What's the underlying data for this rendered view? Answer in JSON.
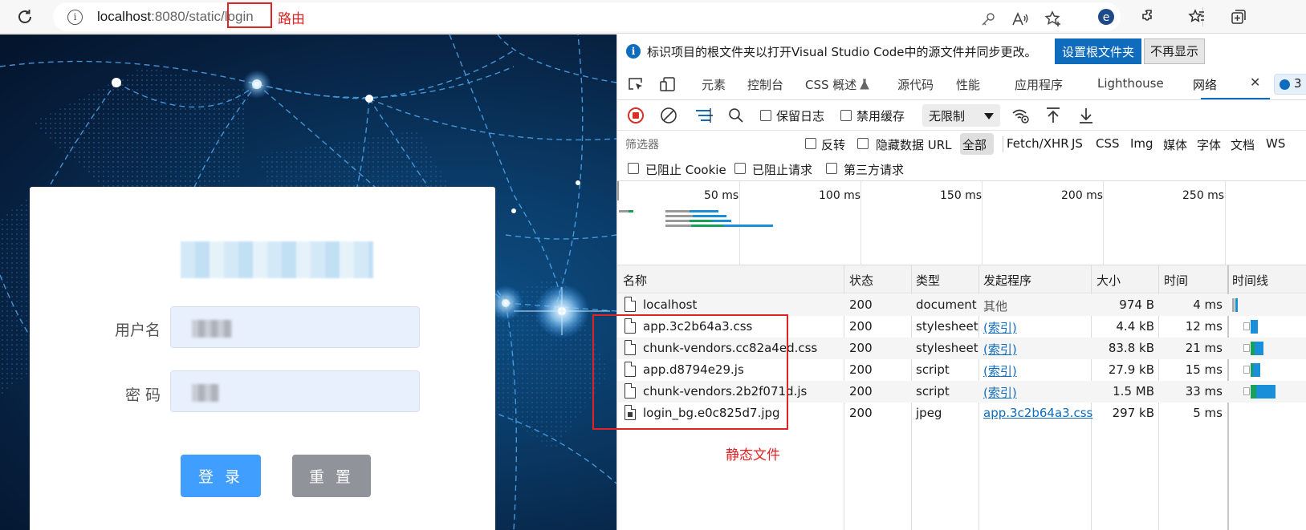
{
  "browser": {
    "url_host": "localhost",
    "url_rest": ":8080/static/",
    "url_path": "login",
    "route_annotation": "路由"
  },
  "login": {
    "username_label": "用户名",
    "password_label": "密 码",
    "login_button": "登 录",
    "reset_button": "重 置"
  },
  "devtools": {
    "banner_message": "标识项目的根文件夹以打开Visual Studio Code中的源文件并同步更改。",
    "banner_primary": "设置根文件夹",
    "banner_secondary": "不再显示",
    "tabs": [
      "元素",
      "控制台",
      "CSS 概述",
      "源代码",
      "性能",
      "应用程序",
      "Lighthouse",
      "网络"
    ],
    "active_tab": "网络",
    "issues_count": "3",
    "toolbar": {
      "preserve_log": "保留日志",
      "disable_cache": "禁用缓存",
      "throttling": "无限制"
    },
    "filter": {
      "placeholder": "筛选器",
      "invert": "反转",
      "hide_data_urls": "隐藏数据 URL",
      "types": [
        "全部",
        "Fetch/XHR",
        "JS",
        "CSS",
        "Img",
        "媒体",
        "字体",
        "文档",
        "WS"
      ],
      "blocked_cookies": "已阻止 Cookie",
      "blocked_requests": "已阻止请求",
      "third_party": "第三方请求"
    },
    "overview_ticks": [
      "50 ms",
      "100 ms",
      "150 ms",
      "200 ms",
      "250 ms"
    ],
    "columns": [
      "名称",
      "状态",
      "类型",
      "发起程序",
      "大小",
      "时间",
      "时间线"
    ],
    "rows": [
      {
        "name": "localhost",
        "status": "200",
        "type": "document",
        "initiator": "其他",
        "size": "974 B",
        "time": "4 ms"
      },
      {
        "name": "app.3c2b64a3.css",
        "status": "200",
        "type": "stylesheet",
        "initiator": "(索引)",
        "size": "4.4 kB",
        "time": "12 ms"
      },
      {
        "name": "chunk-vendors.cc82a4ed.css",
        "status": "200",
        "type": "stylesheet",
        "initiator": "(索引)",
        "size": "83.8 kB",
        "time": "21 ms"
      },
      {
        "name": "app.d8794e29.js",
        "status": "200",
        "type": "script",
        "initiator": "(索引)",
        "size": "27.9 kB",
        "time": "15 ms"
      },
      {
        "name": "chunk-vendors.2b2f071d.js",
        "status": "200",
        "type": "script",
        "initiator": "(索引)",
        "size": "1.5 MB",
        "time": "33 ms"
      },
      {
        "name": "login_bg.e0c825d7.jpg",
        "status": "200",
        "type": "jpeg",
        "initiator": "app.3c2b64a3.css",
        "size": "297 kB",
        "time": "5 ms"
      }
    ],
    "static_annotation": "静态文件"
  },
  "colors": {
    "annotation_red": "#e02424",
    "accent_blue": "#0f6cbd",
    "login_primary": "#409eff",
    "login_reset": "#909399"
  }
}
